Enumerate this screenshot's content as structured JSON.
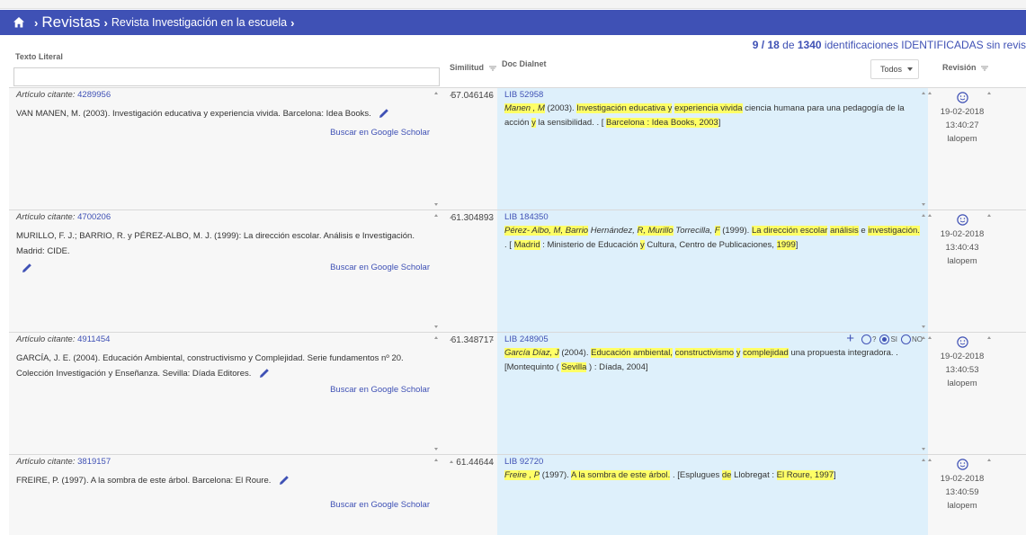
{
  "breadcrumb": {
    "root": "Revistas",
    "journal": "Revista Investigación en la escuela"
  },
  "counter": {
    "current": "9 / 18",
    "de": "de",
    "total": "1340",
    "suffix": "identificaciones IDENTIFICADAS sin revis"
  },
  "columns": {
    "texto_literal": "Texto Literal",
    "similitud": "Similitud",
    "doc_dialnet": "Doc Dialnet",
    "revision": "Revisión",
    "filter_selected": "Todos"
  },
  "labels": {
    "articulo_citante": "Artículo citante:",
    "buscar_scholar": "Buscar en Google Scholar"
  },
  "radio_options": [
    "?",
    "SI",
    "NO"
  ],
  "rows": [
    {
      "citante_id": "4289956",
      "reference": "VAN MANEN, M. (2003). Investigación educativa y experiencia vivida. Barcelona: Idea Books.",
      "similitud": "57.046146",
      "doc_id": "LIB 52958",
      "rev_date": "19-02-2018",
      "rev_time": "13:40:27",
      "rev_user": "lalopem"
    },
    {
      "citante_id": "4700206",
      "reference": "MURILLO, F. J.; BARRIO, R. y PÉREZ-ALBO, M. J. (1999): La dirección escolar. Análisis e Investigación. Madrid: CIDE.",
      "similitud": "61.304893",
      "doc_id": "LIB 184350",
      "rev_date": "19-02-2018",
      "rev_time": "13:40:43",
      "rev_user": "lalopem"
    },
    {
      "citante_id": "4911454",
      "reference": "GARCÍA, J. E. (2004). Educación Ambiental, constructivismo y Complejidad. Serie fundamentos nº 20. Colección Investigación y Enseñanza. Sevilla: Díada Editores.",
      "similitud": "61.348717",
      "doc_id": "LIB 248905",
      "rev_date": "19-02-2018",
      "rev_time": "13:40:53",
      "rev_user": "lalopem"
    },
    {
      "citante_id": "3819157",
      "reference": "FREIRE, P. (1997). A la sombra de este árbol. Barcelona: El Roure.",
      "similitud": "61.44644",
      "doc_id": "LIB 92720",
      "rev_date": "19-02-2018",
      "rev_time": "13:40:59",
      "rev_user": "lalopem"
    }
  ],
  "doc_texts": {
    "r0": {
      "author": "Manen , M",
      "year": "(2003).",
      "t1": "Investigación educativa y",
      "t2": "experiencia vivida",
      "t3": "ciencia humana para una pedagogía de la acción",
      "y": "y",
      "t4": "la",
      "t5": "sensibilidad. . [",
      "pub": "Barcelona : Idea Books, 2003",
      "end": "]"
    },
    "r1": {
      "a1": "Pérez- Albo",
      "a2": ", M, Barrio",
      "a3": "Hernández,",
      "a4": "R, Murillo",
      "a5": "Torrecilla,",
      "a6": "F",
      "year": "(1999).",
      "t1": "La dirección escolar",
      "t2": "análisis",
      "e": "e",
      "t3": "investigación.",
      "t4": ". [",
      "city": "Madrid",
      "t5": ": Ministerio de Educación",
      "y": "y",
      "t6": "Cultura, Centro de Publicaciones,",
      "yr": "1999",
      "end": "]"
    },
    "r2": {
      "author": "García Díaz, J",
      "year": "(2004).",
      "t1": "Educación ambiental,",
      "t2": "constructivismo",
      "y": "y",
      "t3": "complejidad",
      "t4": "una propuesta integradora. . [Montequinto (",
      "city": "Sevilla",
      "t5": ") : Díada, 2004",
      "end": "]"
    },
    "r3": {
      "author": "Freire , P",
      "year": "(1997).",
      "t1": "A la sombra de este árbol.",
      "t2": ". [Esplugues",
      "de": "de",
      "t3": "Llobregat :",
      "pub": "El Roure, 1997",
      "end": "]"
    }
  }
}
